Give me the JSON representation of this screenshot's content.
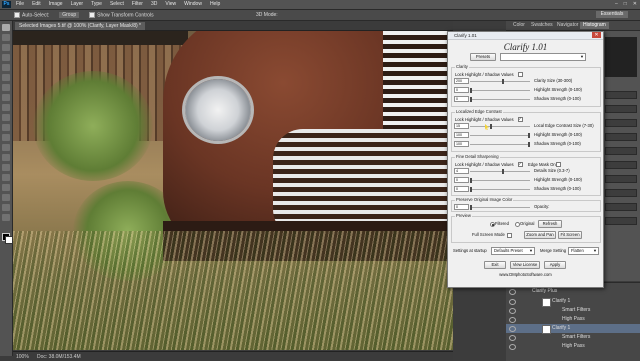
{
  "app": {
    "logo": "Ps",
    "menus": [
      "File",
      "Edit",
      "Image",
      "Layer",
      "Type",
      "Select",
      "Filter",
      "3D",
      "View",
      "Window",
      "Help"
    ],
    "window_controls": [
      "–",
      "□",
      "✕"
    ]
  },
  "options_bar": {
    "auto_select": "Auto-Select:",
    "group": "Group",
    "show_transform": "Show Transform Controls",
    "mode_3d": "3D Mode:",
    "workspace": "Essentials"
  },
  "document": {
    "tab_title": "Selected Images 5.tif @ 100% (Clarify, Layer Mask/8) *",
    "zoom": "100%",
    "doc_size": "Doc: 38.0M/153.4M"
  },
  "panel_tabs": [
    "Color",
    "Swatches",
    "Navigator",
    "Histogram"
  ],
  "panel_tabs_active": 3,
  "layers": [
    {
      "name": "Clarify Plus",
      "indent": 0,
      "selected": false
    },
    {
      "name": "Clarify 1",
      "indent": 1,
      "selected": false
    },
    {
      "name": "Smart Filters",
      "indent": 2,
      "selected": false
    },
    {
      "name": "High Pass",
      "indent": 2,
      "selected": false
    },
    {
      "name": "Clarify 1",
      "indent": 1,
      "selected": false
    },
    {
      "name": "Smart Filters",
      "indent": 2,
      "selected": false
    },
    {
      "name": "High Pass",
      "indent": 2,
      "selected": false
    }
  ],
  "dialog": {
    "titlebar": "Clarify 1.01",
    "close": "✕",
    "heading": "Clarify 1.01",
    "presets_button": "Presets",
    "clarity": {
      "title": "Clarity",
      "lock_label": "Lock Highlight / Shadow Values",
      "lock_checked": false,
      "fields": [
        {
          "value": "200",
          "label": "Clarity Size (30-300)",
          "pos": 0.55
        },
        {
          "value": "0",
          "label": "Highlight Strength (0-100)",
          "pos": 0.0
        },
        {
          "value": "0",
          "label": "Shadow Strength (0-100)",
          "pos": 0.0
        }
      ]
    },
    "local": {
      "title": "Localized Edge Contrast",
      "lock_label": "Lock Highlight / Shadow Values",
      "lock_checked": true,
      "fields": [
        {
          "value": "15",
          "label": "Local Edge Contrast Size (7-30)",
          "pos": 0.35
        },
        {
          "value": "100",
          "label": "Highlight Strength (0-100)",
          "pos": 1.0
        },
        {
          "value": "100",
          "label": "Shadow Strength (0-100)",
          "pos": 1.0
        }
      ]
    },
    "fine": {
      "title": "Fine Detail Sharpening",
      "lock_label": "Lock Highlight / Shadow Values",
      "lock_checked": true,
      "edge_mask_label": "Edge Mask On",
      "edge_mask_checked": false,
      "fields": [
        {
          "value": "4",
          "label": "Details Size (0.3-7)",
          "pos": 0.55
        },
        {
          "value": "0",
          "label": "Highlight Strength (0-100)",
          "pos": 0.0
        },
        {
          "value": "0",
          "label": "Shadow Strength (0-100)",
          "pos": 0.0
        }
      ]
    },
    "preserve": {
      "title": "Preserve Original Image Color",
      "opacity_label": "Opacity:",
      "opacity_value": "0",
      "pos": 0.0
    },
    "preview": {
      "title": "Preview",
      "filtered": "Filtered",
      "original": "Original",
      "refresh": "Refresh",
      "full_screen": "Full Screen Mode",
      "zoom_pan": "Zoom and Pan",
      "fit_screen": "Fit Screen"
    },
    "startup_label": "Settings at startup",
    "startup_value": "Defaults Preset",
    "merge_label": "Merge Setting",
    "merge_value": "Flatten",
    "exit": "Exit",
    "view_license": "View License",
    "apply": "Apply",
    "website": "www.DMphotoSoftware.com"
  }
}
